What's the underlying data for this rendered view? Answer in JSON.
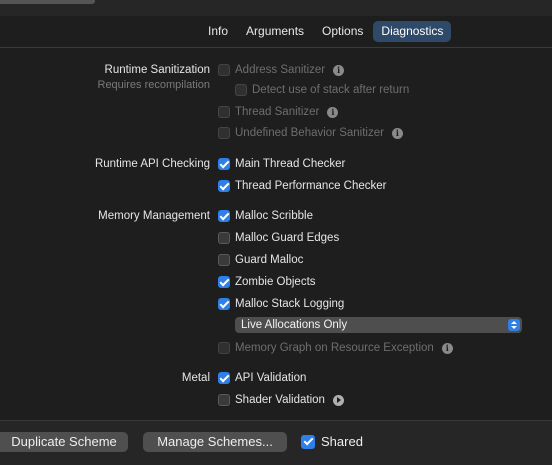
{
  "tabs": [
    {
      "label": "Info",
      "active": false
    },
    {
      "label": "Arguments",
      "active": false
    },
    {
      "label": "Options",
      "active": false
    },
    {
      "label": "Diagnostics",
      "active": true
    }
  ],
  "sections": {
    "runtime_sanitization": {
      "label": "Runtime Sanitization",
      "sublabel": "Requires recompilation",
      "address_sanitizer": {
        "label": "Address Sanitizer",
        "checked": false,
        "enabled": false
      },
      "detect_stack": {
        "label": "Detect use of stack after return",
        "checked": false,
        "enabled": false
      },
      "thread_sanitizer": {
        "label": "Thread Sanitizer",
        "checked": false,
        "enabled": false
      },
      "ub_sanitizer": {
        "label": "Undefined Behavior Sanitizer",
        "checked": false,
        "enabled": false
      }
    },
    "runtime_api": {
      "label": "Runtime API Checking",
      "main_thread_checker": {
        "label": "Main Thread Checker",
        "checked": true
      },
      "thread_perf_checker": {
        "label": "Thread Performance Checker",
        "checked": true
      }
    },
    "memory": {
      "label": "Memory Management",
      "malloc_scribble": {
        "label": "Malloc Scribble",
        "checked": true
      },
      "malloc_guard_edges": {
        "label": "Malloc Guard Edges",
        "checked": false
      },
      "guard_malloc": {
        "label": "Guard Malloc",
        "checked": false
      },
      "zombie_objects": {
        "label": "Zombie Objects",
        "checked": true
      },
      "malloc_stack_logging": {
        "label": "Malloc Stack Logging",
        "checked": true
      },
      "logging_mode": {
        "selected": "Live Allocations Only"
      },
      "memory_graph": {
        "label": "Memory Graph on Resource Exception",
        "checked": false,
        "enabled": false
      }
    },
    "metal": {
      "label": "Metal",
      "api_validation": {
        "label": "API Validation",
        "checked": true
      },
      "shader_validation": {
        "label": "Shader Validation",
        "checked": false
      }
    }
  },
  "footer": {
    "duplicate_label": "Duplicate Scheme",
    "manage_label": "Manage Schemes...",
    "shared_label": "Shared",
    "shared_checked": true
  },
  "colors": {
    "accent": "#2f7fe8",
    "active_tab": "#2e4a68",
    "background": "#1e1e1e"
  }
}
